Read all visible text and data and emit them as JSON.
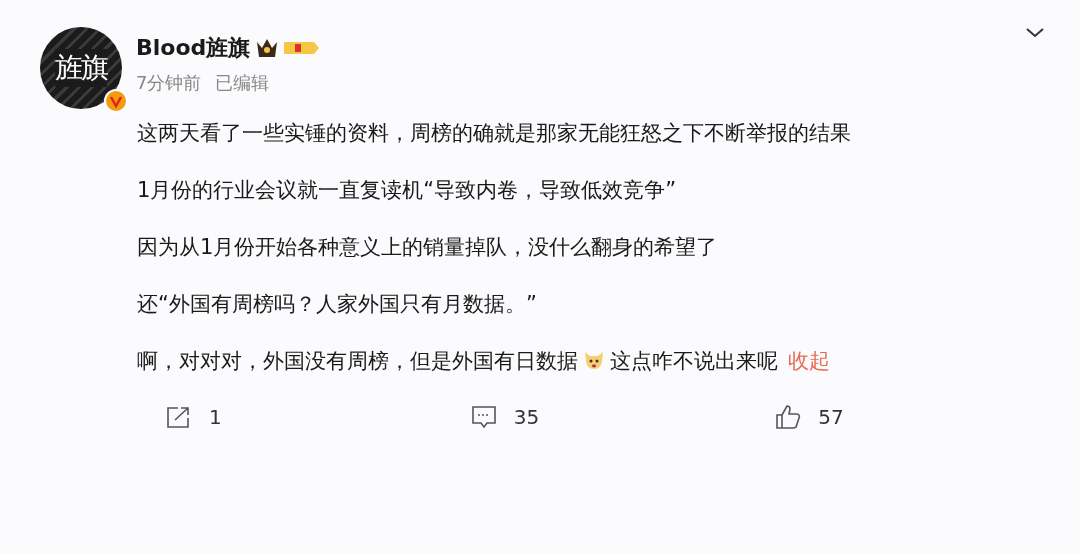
{
  "author": {
    "name": "Blood旌旗",
    "avatar_text": "旌旗",
    "verified": true,
    "time": "7分钟前",
    "edited": "已编辑"
  },
  "paragraphs": [
    "这两天看了一些实锤的资料，周榜的确就是那家无能狂怒之下不断举报的结果",
    "1月份的行业会议就一直复读机“导致内卷，导致低效竞争”",
    "因为从1月份开始各种意义上的销量掉队，没什么翻身的希望了",
    "还“外国有周榜吗？人家外国只有月数据。”"
  ],
  "last_paragraph": {
    "text_before": "啊，对对对，外国没有周榜，但是外国有日数据",
    "text_after": "这点咋不说出来呢",
    "link": "收起"
  },
  "actions": [
    {
      "kind": "share",
      "count": "1"
    },
    {
      "kind": "comment",
      "count": "35"
    },
    {
      "kind": "like",
      "count": "57"
    }
  ]
}
